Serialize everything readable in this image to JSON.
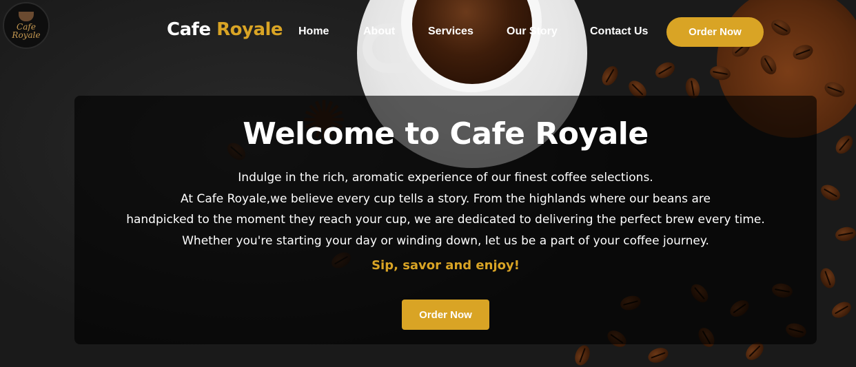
{
  "logo": {
    "text_line1": "Cafe",
    "text_line2": "Royale"
  },
  "brand": {
    "part1": "Cafe ",
    "part2": "Royale"
  },
  "nav": {
    "links": [
      "Home",
      "About",
      "Services",
      "Our Story",
      "Contact Us"
    ],
    "order_label": "Order Now"
  },
  "hero": {
    "title": "Welcome to Cafe Royale",
    "lines": [
      "Indulge in the rich, aromatic experience of our finest coffee selections.",
      "At Cafe Royale,we believe every cup tells a story. From the highlands where our beans are",
      "handpicked to the moment they reach your cup, we are dedicated to delivering the perfect brew every time.",
      "Whether you're starting your day or winding down, let us be a part of your coffee journey."
    ],
    "tagline": "Sip, savor and enjoy!",
    "order_label": "Order Now"
  },
  "colors": {
    "accent": "#d9a425",
    "overlay": "#000000",
    "text": "#ffffff"
  }
}
